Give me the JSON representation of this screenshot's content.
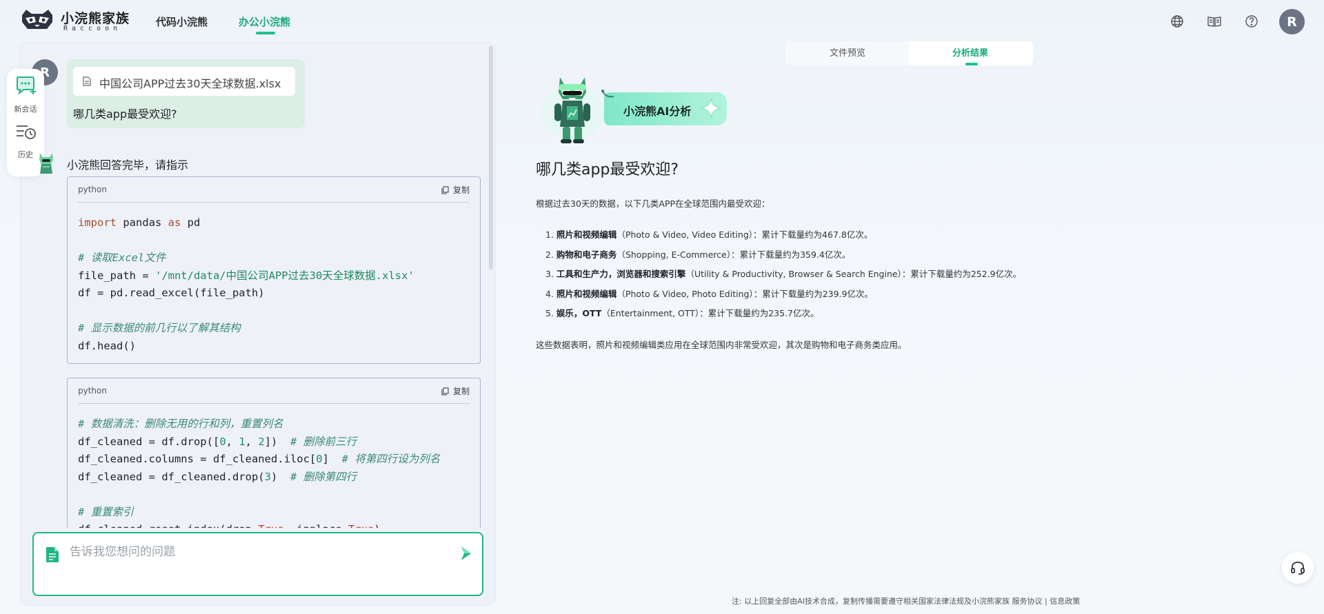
{
  "header": {
    "logo_title": "小浣熊家族",
    "logo_subtitle": "Raccoon",
    "nav": [
      {
        "label": "代码小浣熊",
        "active": false
      },
      {
        "label": "办公小浣熊",
        "active": true
      }
    ],
    "icons": [
      "globe-icon",
      "book-icon",
      "help-icon"
    ],
    "avatar_letter": "R"
  },
  "sidebar": {
    "new_chat_label": "新会话",
    "history_label": "历史"
  },
  "chat": {
    "user_avatar": "R",
    "file_name": "中国公司APP过去30天全球数据.xlsx",
    "question": "哪几类app最受欢迎?",
    "bot_message": "小浣熊回答完毕，请指示",
    "code_blocks": [
      {
        "lang": "python",
        "copy_label": "复制"
      },
      {
        "lang": "python",
        "copy_label": "复制"
      }
    ],
    "input_placeholder": "告诉我您想问的问题"
  },
  "result": {
    "tabs": [
      {
        "label": "文件预览",
        "active": false
      },
      {
        "label": "分析结果",
        "active": true
      }
    ],
    "badge": "小浣熊AI分析",
    "title": "哪几类app最受欢迎?",
    "intro": "根据过去30天的数据，以下几类APP在全球范围内最受欢迎：",
    "items": [
      {
        "num": "1.",
        "name": "照片和视频编辑",
        "en": "（Photo & Video, Video Editing）",
        "desc": "：累计下载量约为467.8亿次。"
      },
      {
        "num": "2.",
        "name": "购物和电子商务",
        "en": "（Shopping, E-Commerce）",
        "desc": "：累计下载量约为359.4亿次。"
      },
      {
        "num": "3.",
        "name": "工具和生产力，浏览器和搜索引擎",
        "en": "（Utility & Productivity, Browser & Search Engine）",
        "desc": "：累计下载量约为252.9亿次。"
      },
      {
        "num": "4.",
        "name": "照片和视频编辑",
        "en": "（Photo & Video, Photo Editing）",
        "desc": "：累计下载量约为239.9亿次。"
      },
      {
        "num": "5.",
        "name": "娱乐，OTT",
        "en": "（Entertainment, OTT）",
        "desc": "：累计下载量约为235.7亿次。"
      }
    ],
    "conclusion": "这些数据表明，照片和视频编辑类应用在全球范围内非常受欢迎，其次是购物和电子商务类应用。"
  },
  "footer": {
    "note": "注: 以上回复全部由AI技术合成，复制传播需要遵守相关国家法律法规及小浣熊家族",
    "link1": "服务协议",
    "sep": "|",
    "link2": "信息政策"
  }
}
